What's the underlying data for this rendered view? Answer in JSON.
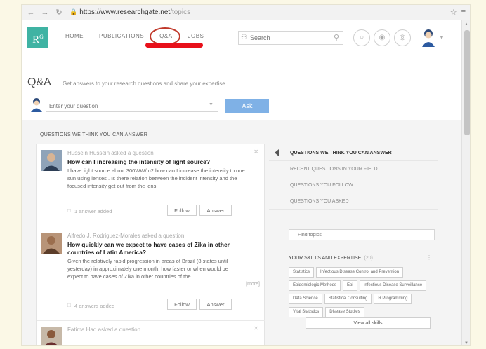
{
  "browser": {
    "url_host": "https://www.researchgate.net",
    "url_path": "/topics"
  },
  "header": {
    "logo_text": "R",
    "logo_sup": "G",
    "nav": [
      "HOME",
      "PUBLICATIONS",
      "Q&A",
      "JOBS"
    ],
    "search_placeholder": "Search"
  },
  "qa": {
    "title": "Q&A",
    "subtitle": "Get answers to your research questions and share your expertise",
    "ask_placeholder": "Enter your question",
    "ask_button": "Ask"
  },
  "content": {
    "heading": "QUESTIONS WE THINK YOU CAN ANSWER"
  },
  "feed": [
    {
      "author": "Hussein Hussein asked a question",
      "question": "How can I increasing the intensity of light source?",
      "body": "I have light source about 300WW/m2 how can I increase the intensity to one sun using lenses . Is there relation between the incident intensity and the focused intensity get out from the lens",
      "meta": "1 answer added",
      "follow": "Follow",
      "answer": "Answer"
    },
    {
      "author": "Alfredo J. Rodriguez-Morales asked a question",
      "question": "How quickly can we expect to have cases of Zika in other countries of Latin America?",
      "body": "Given the relatively rapid progression in areas of Brazil (8 states until yesterday) in approximately one month, how faster or when would be expect to have cases of Zika in other countries of the",
      "more": "[more]",
      "meta": "4 answers added",
      "follow": "Follow",
      "answer": "Answer"
    },
    {
      "author": "Fatima Haq asked a question"
    }
  ],
  "side_nav": [
    "QUESTIONS WE THINK YOU CAN ANSWER",
    "RECENT QUESTIONS IN YOUR FIELD",
    "QUESTIONS YOU FOLLOW",
    "QUESTIONS YOU ASKED"
  ],
  "skills": {
    "filter_placeholder": "Find topics",
    "title": "YOUR SKILLS AND EXPERTISE",
    "count": "(20)",
    "tags": [
      "Statistics",
      "Infectious Disease Control and Prevention",
      "Epidemiologic Methods",
      "Epi",
      "Infectious Disease Surveillance",
      "Data Science",
      "Statistical Consulting",
      "R Programming",
      "Vital Statistics",
      "Disease Studies"
    ],
    "view_all": "View all skills"
  }
}
